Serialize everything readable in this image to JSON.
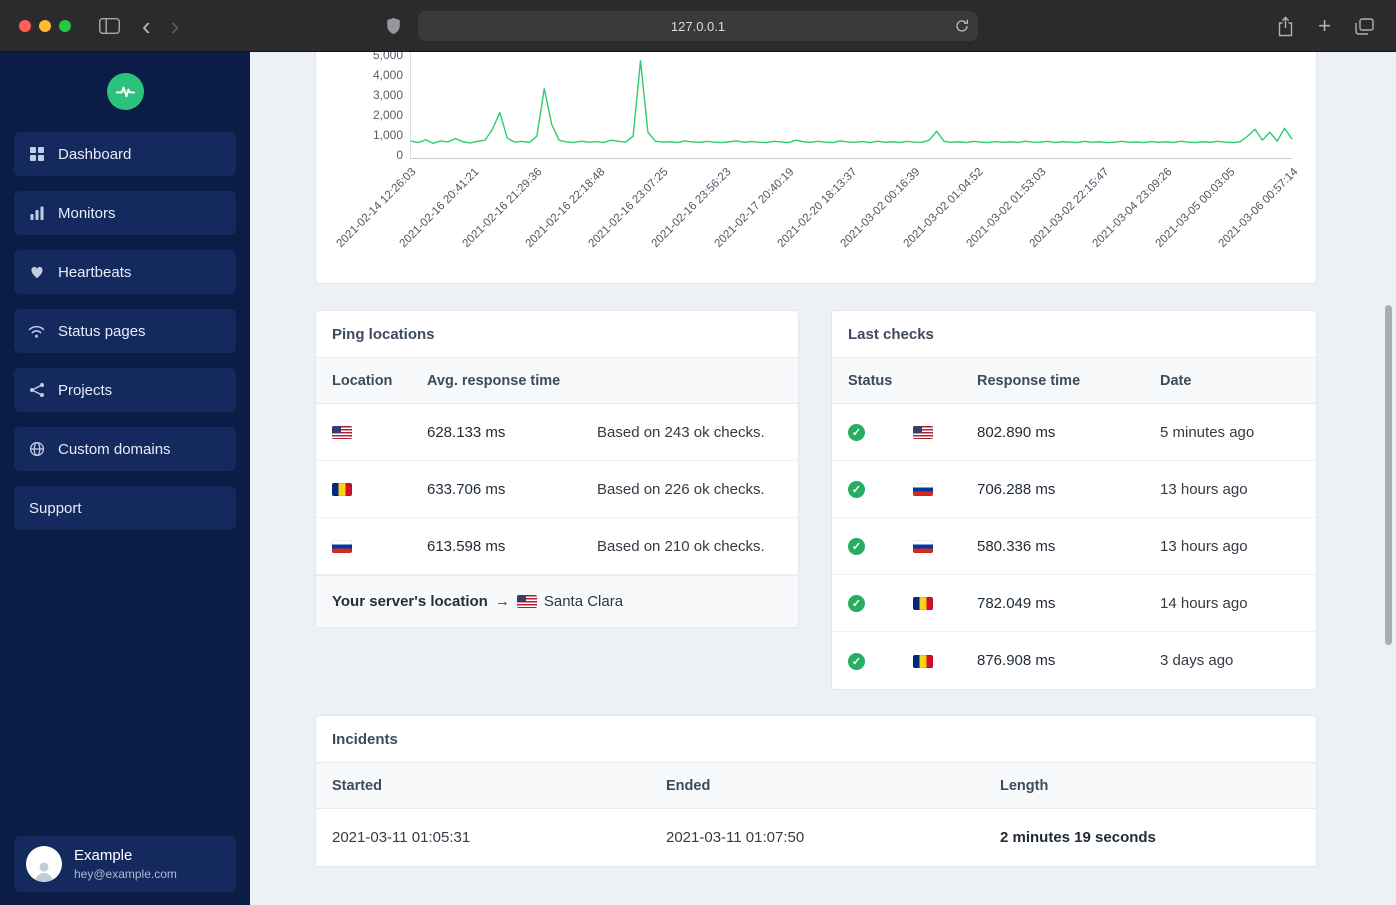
{
  "browser": {
    "url": "127.0.0.1",
    "icons": {
      "back": "‹",
      "forward": "›",
      "plus": "+"
    }
  },
  "sidebar": {
    "items": [
      {
        "label": "Dashboard",
        "icon": "grid-icon"
      },
      {
        "label": "Monitors",
        "icon": "bar-chart-icon"
      },
      {
        "label": "Heartbeats",
        "icon": "heart-icon"
      },
      {
        "label": "Status pages",
        "icon": "wifi-icon"
      },
      {
        "label": "Projects",
        "icon": "share-nodes-icon"
      },
      {
        "label": "Custom domains",
        "icon": "globe-icon"
      },
      {
        "label": "Support",
        "icon": ""
      }
    ],
    "user": {
      "name": "Example",
      "email": "hey@example.com"
    }
  },
  "chart_data": {
    "type": "line",
    "title": "",
    "xlabel": "",
    "ylabel": "",
    "ylim": [
      0,
      5000
    ],
    "yticks": [
      0,
      1000,
      2000,
      3000,
      4000,
      5000
    ],
    "color": "#2ecc71",
    "grid": false,
    "x": [
      "2021-02-14 12:26:03",
      "2021-02-16 20:41:21",
      "2021-02-16 21:29:36",
      "2021-02-16 22:18:48",
      "2021-02-16 23:07:25",
      "2021-02-16 23:56:23",
      "2021-02-17 20:40:19",
      "2021-02-20 18:13:37",
      "2021-03-02 00:16:39",
      "2021-03-02 01:04:52",
      "2021-03-02 01:53:03",
      "2021-03-02 22:15:47",
      "2021-03-04 23:09:26",
      "2021-03-05 00:03:05",
      "2021-03-06 00:57:14"
    ],
    "values": [
      650,
      580,
      720,
      540,
      660,
      610,
      780,
      620,
      560,
      640,
      700,
      1250,
      2100,
      800,
      600,
      640,
      580,
      900,
      3300,
      1500,
      700,
      610,
      580,
      650,
      600,
      630,
      580,
      700,
      640,
      600,
      900,
      4700,
      1100,
      650,
      600,
      620,
      580,
      660,
      610,
      590,
      640,
      600,
      580,
      620,
      660,
      590,
      630,
      600,
      580,
      640,
      610,
      580,
      700,
      620,
      590,
      640,
      600,
      580,
      660,
      610,
      590,
      630,
      580,
      650,
      600,
      620,
      580,
      640,
      600,
      590,
      700,
      1150,
      640,
      590,
      620,
      580,
      640,
      600,
      580,
      630,
      590,
      620,
      580,
      650,
      600,
      590,
      640,
      580,
      620,
      600,
      580,
      640,
      590,
      620,
      580,
      600,
      640,
      590,
      610,
      580,
      630,
      590,
      620,
      580,
      650,
      600,
      580,
      620,
      590,
      640,
      600,
      580,
      620,
      900,
      1250,
      700,
      1100,
      650,
      1300,
      750
    ]
  },
  "cards": {
    "ping_locations": {
      "title": "Ping locations",
      "columns": [
        "Location",
        "Avg. response time"
      ],
      "rows": [
        {
          "flag": "us",
          "avg": "628.133 ms",
          "note": "Based on 243 ok checks."
        },
        {
          "flag": "ro",
          "avg": "633.706 ms",
          "note": "Based on 226 ok checks."
        },
        {
          "flag": "ru",
          "avg": "613.598 ms",
          "note": "Based on 210 ok checks."
        }
      ],
      "footer": {
        "label": "Your server's location",
        "arrow": "→",
        "flag": "us",
        "location": "Santa Clara"
      }
    },
    "last_checks": {
      "title": "Last checks",
      "columns": [
        "Status",
        "Response time",
        "Date"
      ],
      "ok_glyph": "✓",
      "rows": [
        {
          "status": "up",
          "flag": "us",
          "response": "802.890 ms",
          "date": "5 minutes ago"
        },
        {
          "status": "up",
          "flag": "ru",
          "response": "706.288 ms",
          "date": "13 hours ago"
        },
        {
          "status": "up",
          "flag": "ru",
          "response": "580.336 ms",
          "date": "13 hours ago"
        },
        {
          "status": "up",
          "flag": "ro",
          "response": "782.049 ms",
          "date": "14 hours ago"
        },
        {
          "status": "up",
          "flag": "ro",
          "response": "876.908 ms",
          "date": "3 days ago"
        }
      ]
    },
    "incidents": {
      "title": "Incidents",
      "columns": [
        "Started",
        "Ended",
        "Length"
      ],
      "rows": [
        {
          "started": "2021-03-11 01:05:31",
          "ended": "2021-03-11 01:07:50",
          "length": "2 minutes 19 seconds"
        }
      ]
    }
  },
  "colors": {
    "accent_green": "#2bc27d",
    "status_ok": "#27ae60",
    "sidebar_bg": "#0b1d47"
  }
}
